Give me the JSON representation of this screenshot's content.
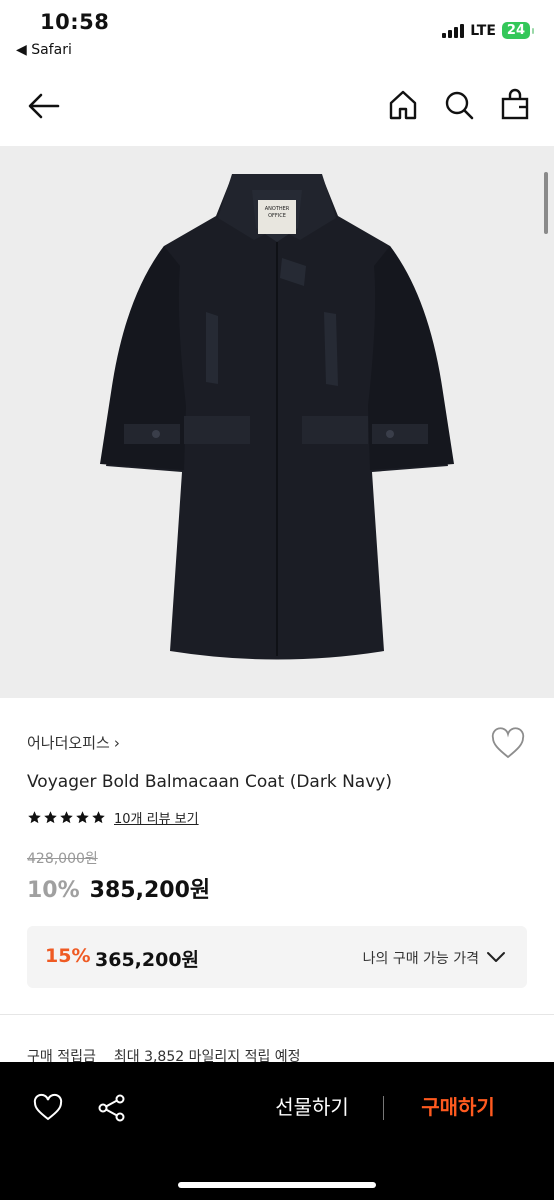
{
  "status": {
    "time": "10:58",
    "back_label": "◀ Safari",
    "network": "LTE",
    "battery": "24"
  },
  "icons": {
    "back": "arrow-left-icon",
    "home": "home-icon",
    "search": "search-icon",
    "bag": "shopping-bag-icon",
    "wishlist": "heart-icon",
    "share": "share-icon",
    "chevron": "chevron-down-icon"
  },
  "product": {
    "brand": "어나더오피스",
    "brand_arrow": "›",
    "name": "Voyager Bold Balmacaan Coat (Dark Navy)",
    "rating": 5,
    "review_link": "10개 리뷰 보기",
    "original_price": "428,000원",
    "discount": "10%",
    "price": "385,200원",
    "image_label_line1": "ANOTHER",
    "image_label_line2": "OFFICE"
  },
  "member_price": {
    "discount": "15%",
    "price": "365,200원",
    "label": "나의 구매 가능 가격"
  },
  "points": {
    "label": "구매 적립금",
    "value": "최대 3,852 마일리지 적립 예정"
  },
  "bottom": {
    "gift_label": "선물하기",
    "buy_label": "구매하기"
  },
  "colors": {
    "accent": "#ff5a1f",
    "member_discount": "#ef5a23",
    "bar_bg": "#000000",
    "image_bg": "#ededed",
    "coat": "#1b1d25"
  }
}
